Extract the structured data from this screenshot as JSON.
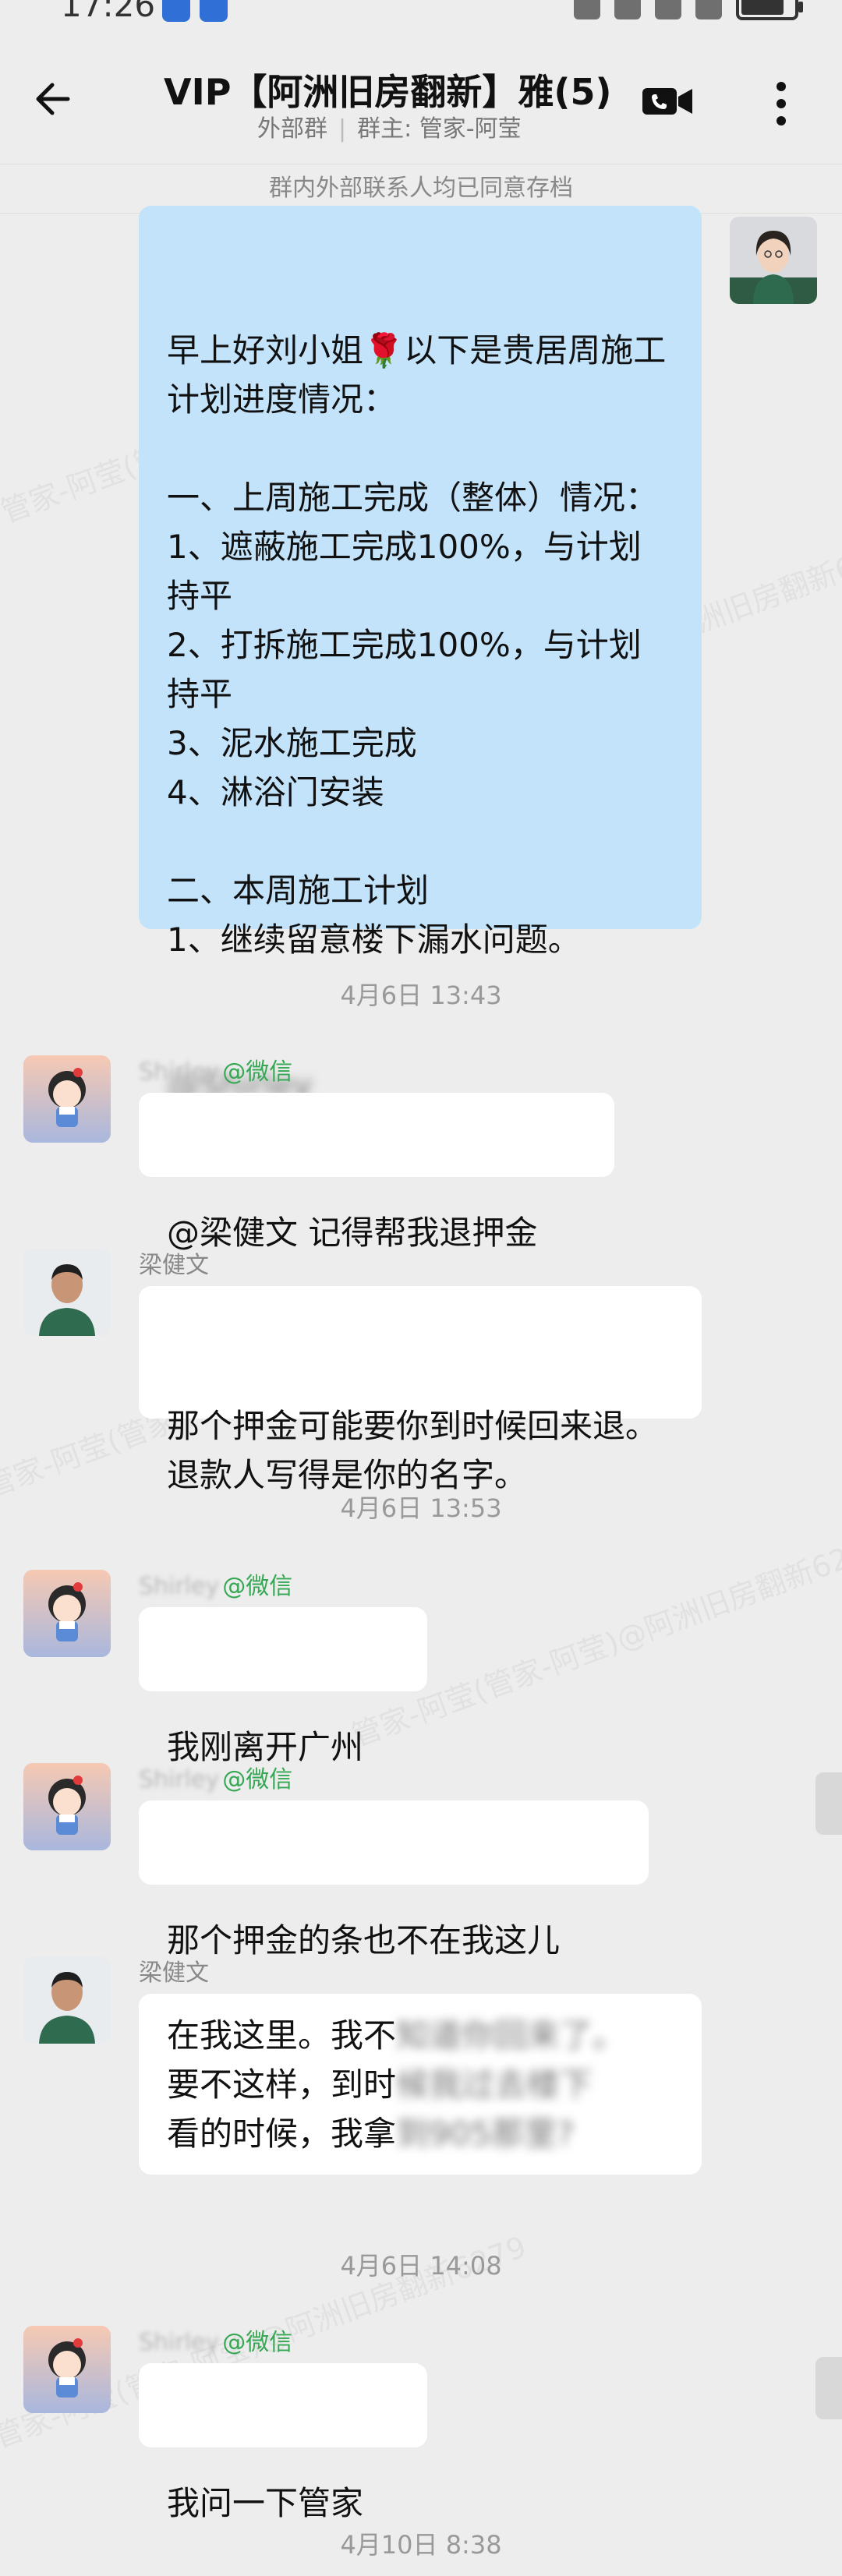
{
  "status_bar": {
    "time": "17:26"
  },
  "header": {
    "title": "VIP【阿洲旧房翻新】雅(5)",
    "group_type": "外部群",
    "group_owner": "群主: 管家-阿莹"
  },
  "consent_notice": "群内外部联系人均已同意存档",
  "watermark_text": "管家-阿莹(管家-阿莹)@阿洲旧房翻新6279",
  "messages": [
    {
      "kind": "outgoing",
      "text": "早上好刘小姐🌹以下是贵居周施工计划进度情况：\n\n一、上周施工完成（整体）情况：\n1、遮蔽施工完成100%，与计划持平\n2、打拆施工完成100%，与计划持平\n3、泥水施工完成\n4、淋浴门安装\n\n二、本周施工计划\n1、继续留意楼下漏水问题。",
      "mention_blurred": "@Shirley"
    },
    {
      "kind": "time",
      "text": "4月6日 13:43"
    },
    {
      "kind": "incoming",
      "sender": "Shirley",
      "source": "@微信",
      "text": "@梁健文 记得帮我退押金"
    },
    {
      "kind": "incoming",
      "sender": "梁健文",
      "text": "那个押金可能要你到时候回来退。退款人写得是你的名字。"
    },
    {
      "kind": "time",
      "text": "4月6日 13:53"
    },
    {
      "kind": "incoming",
      "sender": "Shirley",
      "source": "@微信",
      "text": "我刚离开广州"
    },
    {
      "kind": "incoming",
      "sender": "Shirley",
      "source": "@微信",
      "text": "那个押金的条也不在我这儿"
    },
    {
      "kind": "incoming",
      "sender": "梁健文",
      "line1_visible": "在我这里。我不",
      "line1_blurred": "知道你回来了。",
      "line2_visible": "要不这样，到时",
      "line2_blurred": "候我过去楼下",
      "line3_visible": "看的时候，我拿",
      "line3_blurred": "到905那里?"
    },
    {
      "kind": "time",
      "text": "4月6日 14:08"
    },
    {
      "kind": "incoming",
      "sender": "Shirley",
      "source": "@微信",
      "text": "我问一下管家"
    },
    {
      "kind": "time",
      "text": "4月10日 8:38"
    }
  ]
}
